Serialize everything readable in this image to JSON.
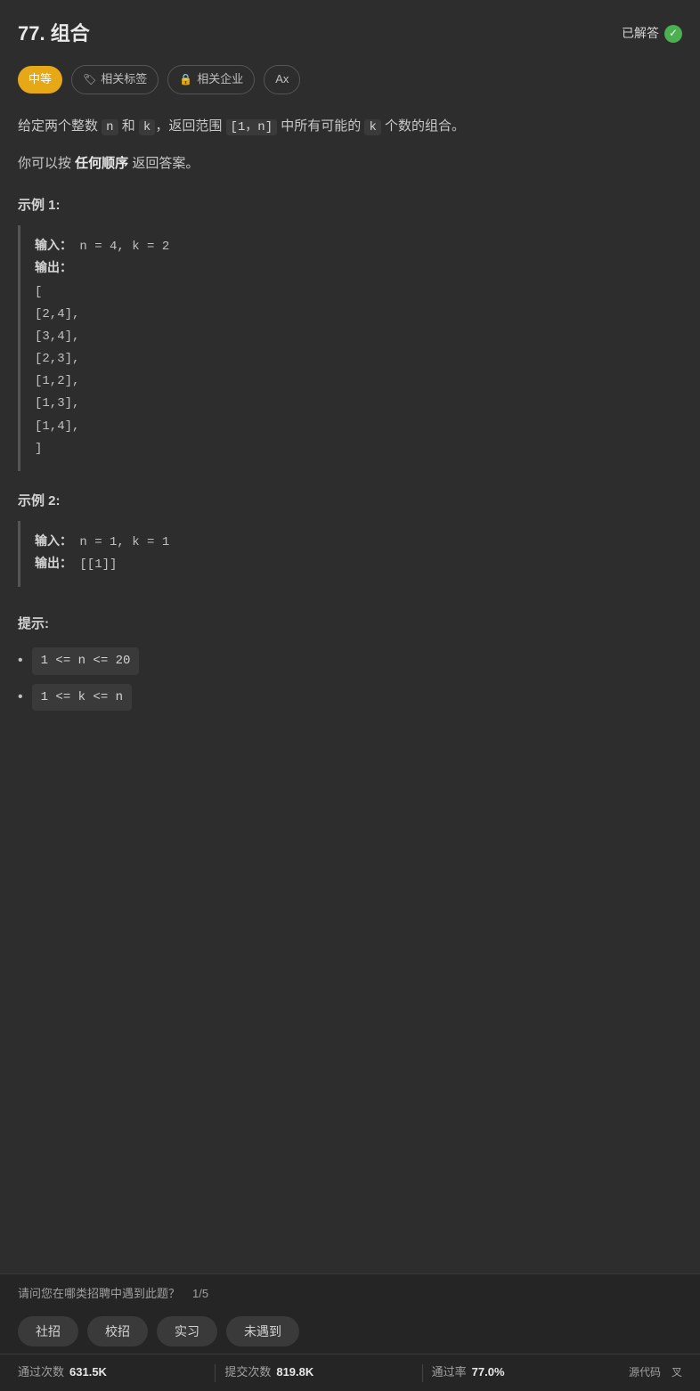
{
  "page": {
    "title": "77. 组合",
    "solved_label": "已解答",
    "difficulty": "中等",
    "tags": [
      {
        "id": "related-tags",
        "icon": "🏷",
        "label": "相关标签"
      },
      {
        "id": "related-companies",
        "icon": "🔒",
        "label": "相关企业"
      },
      {
        "id": "font-size",
        "icon": "Ax",
        "label": ""
      }
    ],
    "description_part1": "给定两个整数 ",
    "description_n": "n",
    "description_and": " 和 ",
    "description_k": "k",
    "description_part2": "，返回范围 ",
    "description_range": "[1，n]",
    "description_part3": " 中所有可能的 ",
    "description_k2": "k",
    "description_part4": " 个数的组合。",
    "description_line2_1": "你可以按 ",
    "description_bold": "任何顺序",
    "description_line2_2": " 返回答案。",
    "example1_title": "示例 1:",
    "example1_input_label": "输入：",
    "example1_input_value": "n = 4, k = 2",
    "example1_output_label": "输出：",
    "example1_output_value": "[\n    [2,4],\n    [3,4],\n    [2,3],\n    [1,2],\n    [1,3],\n    [1,4],\n]",
    "example2_title": "示例 2:",
    "example2_input_label": "输入：",
    "example2_input_value": "n = 1, k = 1",
    "example2_output_label": "输出：",
    "example2_output_value": "[[1]]",
    "hints_title": "提示:",
    "hint1": "1 <= n <= 20",
    "hint2": "1 <= k <= n",
    "recruitment_question": "请问您在哪类招聘中遇到此题？",
    "recruitment_count": "1/5",
    "recruit_options": [
      "社招",
      "校招",
      "实习",
      "未遇到"
    ],
    "stats": [
      {
        "label": "通过次数",
        "value": "631.5K"
      },
      {
        "label": "提交次数",
        "value": "819.8K"
      },
      {
        "label": "通过率",
        "value": "77.0%"
      }
    ],
    "source_links": [
      "源代码",
      "叉"
    ]
  }
}
